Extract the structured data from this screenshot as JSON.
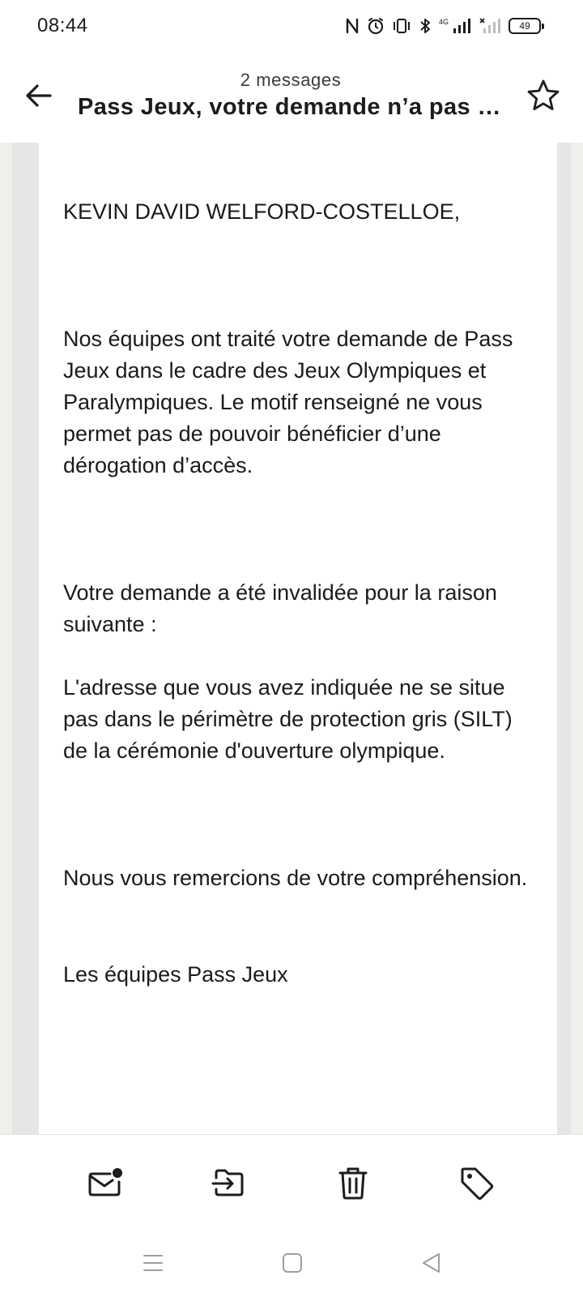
{
  "status_bar": {
    "time": "08:44",
    "battery": "49",
    "network": "4G",
    "icons": [
      "nfc-icon",
      "alarm-icon",
      "vibrate-icon",
      "bluetooth-icon",
      "signal-4g-icon",
      "signal-no-sim-icon",
      "battery-icon"
    ]
  },
  "header": {
    "message_count": "2 messages",
    "title": "Pass Jeux, votre demande n’a pas été validée",
    "back_icon": "arrow-left-icon",
    "star_icon": "star-outline-icon"
  },
  "email": {
    "greeting": "KEVIN DAVID WELFORD-COSTELLOE,",
    "paragraph_1": "Nos équipes ont traité votre demande de Pass Jeux dans le cadre des Jeux Olympiques et Paralympiques. Le motif renseigné ne vous permet pas de pouvoir bénéficier d’une dérogation d’accès.",
    "paragraph_2": "Votre demande a été invalidée pour la raison suivante :",
    "paragraph_3": "L'adresse que vous avez indiquée ne se situe pas dans le périmètre de protection gris (SILT) de la cérémonie d'ouverture olympique.",
    "paragraph_4": "Nous vous remercions de votre compréhension.",
    "signature": "Les équipes Pass Jeux"
  },
  "actions": {
    "mark_unread_icon": "mail-unread-icon",
    "move_icon": "move-to-folder-icon",
    "delete_icon": "trash-icon",
    "label_icon": "tag-icon"
  },
  "nav": {
    "menu_icon": "recent-apps-icon",
    "home_icon": "home-icon",
    "back_icon": "back-triangle-icon"
  },
  "colors": {
    "text": "#1c1b1f",
    "frame": "#e6e6e6",
    "background": "#f1efec"
  }
}
